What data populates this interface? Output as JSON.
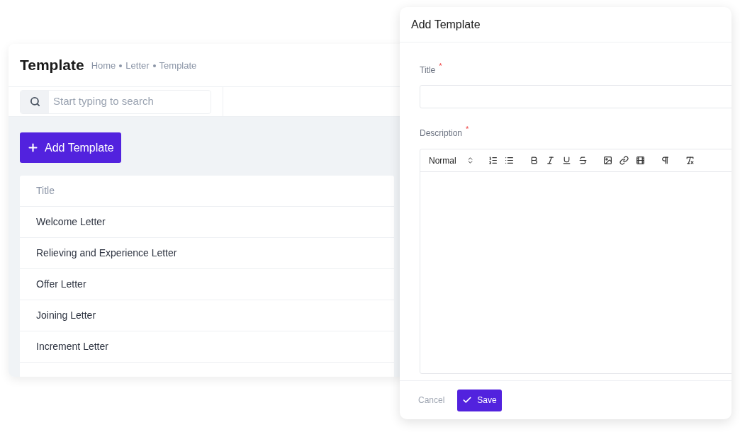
{
  "page": {
    "title": "Template",
    "breadcrumb": [
      "Home",
      "Letter",
      "Template"
    ]
  },
  "search": {
    "placeholder": "Start typing to search"
  },
  "add_button": {
    "label": "Add Template"
  },
  "table": {
    "columns": [
      "Title"
    ],
    "rows": [
      {
        "title": "Welcome Letter"
      },
      {
        "title": "Relieving and Experience Letter"
      },
      {
        "title": "Offer Letter"
      },
      {
        "title": "Joining Letter"
      },
      {
        "title": "Increment Letter"
      }
    ]
  },
  "modal": {
    "title": "Add Template",
    "fields": [
      {
        "kind": "text",
        "label": "Title",
        "required_mark": "*"
      },
      {
        "kind": "editor",
        "label": "Description",
        "required_mark": "*",
        "format": "Normal"
      }
    ],
    "buttons": [
      {
        "kind": "cancel",
        "label": "Cancel"
      },
      {
        "kind": "primary",
        "label": "Save"
      }
    ]
  }
}
